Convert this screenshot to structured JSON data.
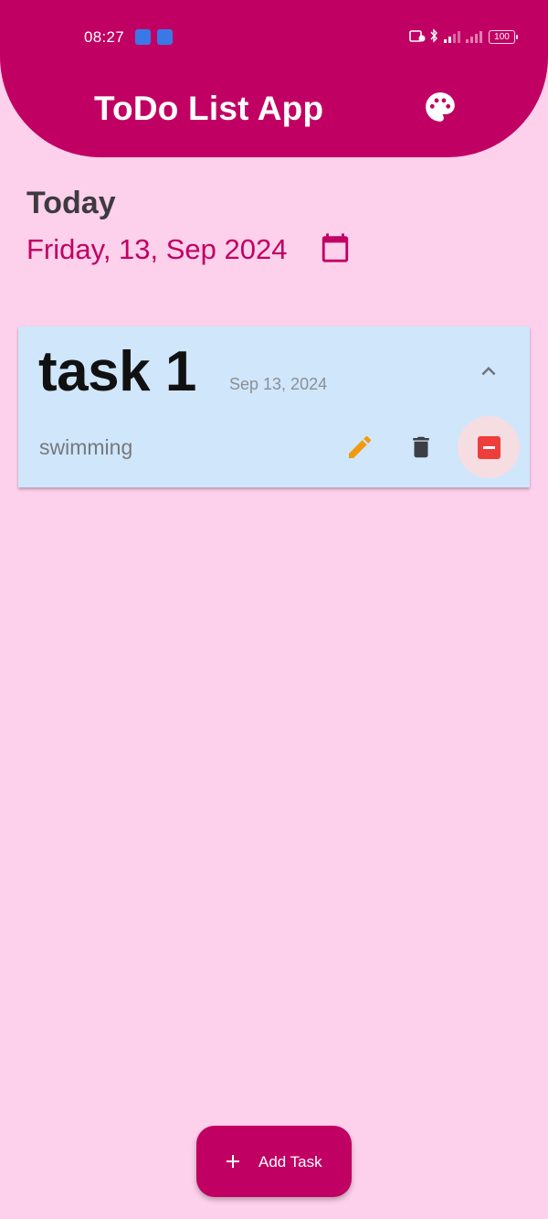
{
  "status_bar": {
    "time": "08:27",
    "battery": "100"
  },
  "app_bar": {
    "title": "ToDo List App",
    "palette_icon": "palette-icon"
  },
  "header": {
    "today_label": "Today",
    "date_label": "Friday, 13, Sep 2024",
    "calendar_icon": "calendar-icon"
  },
  "tasks": [
    {
      "title": "task 1",
      "date": "Sep 13, 2024",
      "description": "swimming",
      "expanded": true,
      "icons": {
        "collapse": "chevron-up-icon",
        "edit": "pencil-icon",
        "delete": "trash-icon",
        "remove": "minus-box-icon"
      }
    }
  ],
  "fab": {
    "label": "Add Task",
    "icon": "plus-icon"
  },
  "colors": {
    "primary": "#c10063",
    "background": "#fdd0eb",
    "card": "#cfe6fb",
    "edit_icon": "#f29a0e",
    "delete_icon": "#3d3e45",
    "remove_icon": "#ee3e3b"
  }
}
